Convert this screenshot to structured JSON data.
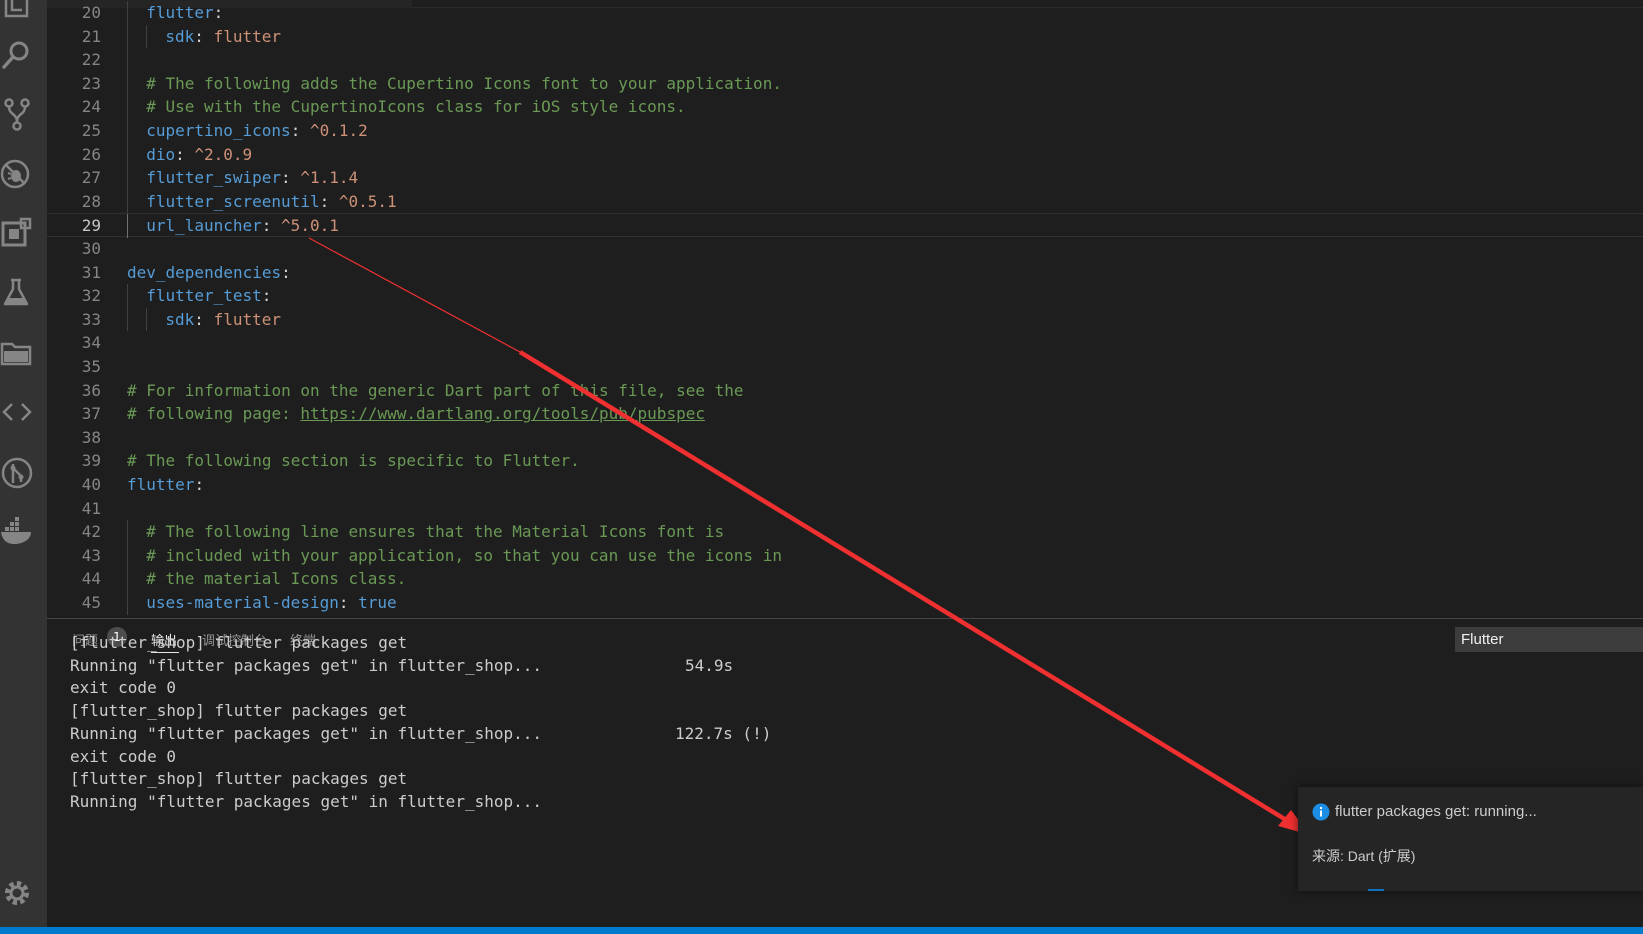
{
  "editor": {
    "lines": [
      {
        "n": "20",
        "indent": 1,
        "tokens": [
          {
            "t": "flutter",
            "c": "t-key"
          },
          {
            "t": ":",
            "c": "t-punc"
          }
        ]
      },
      {
        "n": "21",
        "indent": 2,
        "tokens": [
          {
            "t": "sdk",
            "c": "t-key"
          },
          {
            "t": ": ",
            "c": "t-punc"
          },
          {
            "t": "flutter",
            "c": "t-str"
          }
        ]
      },
      {
        "n": "22",
        "indent": 1,
        "tokens": []
      },
      {
        "n": "23",
        "indent": 1,
        "tokens": [
          {
            "t": "# The following adds the Cupertino Icons font to your application.",
            "c": "t-com"
          }
        ]
      },
      {
        "n": "24",
        "indent": 1,
        "tokens": [
          {
            "t": "# Use with the CupertinoIcons class for iOS style icons.",
            "c": "t-com"
          }
        ]
      },
      {
        "n": "25",
        "indent": 1,
        "tokens": [
          {
            "t": "cupertino_icons",
            "c": "t-key"
          },
          {
            "t": ": ",
            "c": "t-punc"
          },
          {
            "t": "^0.1.2",
            "c": "t-str"
          }
        ]
      },
      {
        "n": "26",
        "indent": 1,
        "tokens": [
          {
            "t": "dio",
            "c": "t-key"
          },
          {
            "t": ": ",
            "c": "t-punc"
          },
          {
            "t": "^2.0.9",
            "c": "t-str"
          }
        ]
      },
      {
        "n": "27",
        "indent": 1,
        "tokens": [
          {
            "t": "flutter_swiper",
            "c": "t-key"
          },
          {
            "t": ": ",
            "c": "t-punc"
          },
          {
            "t": "^1.1.4",
            "c": "t-str"
          }
        ]
      },
      {
        "n": "28",
        "indent": 1,
        "tokens": [
          {
            "t": "flutter_screenutil",
            "c": "t-key"
          },
          {
            "t": ": ",
            "c": "t-punc"
          },
          {
            "t": "^0.5.1",
            "c": "t-str"
          }
        ]
      },
      {
        "n": "29",
        "indent": 1,
        "current": true,
        "tokens": [
          {
            "t": "url_launcher",
            "c": "t-key"
          },
          {
            "t": ": ",
            "c": "t-punc"
          },
          {
            "t": "^5.0.1",
            "c": "t-str"
          }
        ]
      },
      {
        "n": "30",
        "indent": 0,
        "tokens": []
      },
      {
        "n": "31",
        "indent": 0,
        "tokens": [
          {
            "t": "dev_dependencies",
            "c": "t-key"
          },
          {
            "t": ":",
            "c": "t-punc"
          }
        ]
      },
      {
        "n": "32",
        "indent": 1,
        "tokens": [
          {
            "t": "flutter_test",
            "c": "t-key"
          },
          {
            "t": ":",
            "c": "t-punc"
          }
        ]
      },
      {
        "n": "33",
        "indent": 2,
        "tokens": [
          {
            "t": "sdk",
            "c": "t-key"
          },
          {
            "t": ": ",
            "c": "t-punc"
          },
          {
            "t": "flutter",
            "c": "t-str"
          }
        ]
      },
      {
        "n": "34",
        "indent": 0,
        "tokens": []
      },
      {
        "n": "35",
        "indent": 0,
        "tokens": []
      },
      {
        "n": "36",
        "indent": 0,
        "tokens": [
          {
            "t": "# For information on the generic Dart part of this file, see the",
            "c": "t-com"
          }
        ]
      },
      {
        "n": "37",
        "indent": 0,
        "tokens": [
          {
            "t": "# following page: ",
            "c": "t-com"
          },
          {
            "t": "https://www.dartlang.org/tools/pub/pubspec",
            "c": "t-link"
          }
        ]
      },
      {
        "n": "38",
        "indent": 0,
        "tokens": []
      },
      {
        "n": "39",
        "indent": 0,
        "tokens": [
          {
            "t": "# The following section is specific to Flutter.",
            "c": "t-com"
          }
        ]
      },
      {
        "n": "40",
        "indent": 0,
        "tokens": [
          {
            "t": "flutter",
            "c": "t-key"
          },
          {
            "t": ":",
            "c": "t-punc"
          }
        ]
      },
      {
        "n": "41",
        "indent": 0,
        "tokens": []
      },
      {
        "n": "42",
        "indent": 1,
        "tokens": [
          {
            "t": "# The following line ensures that the Material Icons font is",
            "c": "t-com"
          }
        ]
      },
      {
        "n": "43",
        "indent": 1,
        "tokens": [
          {
            "t": "# included with your application, so that you can use the icons in",
            "c": "t-com"
          }
        ]
      },
      {
        "n": "44",
        "indent": 1,
        "tokens": [
          {
            "t": "# the material Icons class.",
            "c": "t-com"
          }
        ]
      },
      {
        "n": "45",
        "indent": 1,
        "tokens": [
          {
            "t": "uses-material-design",
            "c": "t-key"
          },
          {
            "t": ": ",
            "c": "t-punc"
          },
          {
            "t": "true",
            "c": "t-kw"
          }
        ]
      }
    ]
  },
  "panel": {
    "tabs": {
      "problems": "问题",
      "problems_count": "1",
      "output": "输出",
      "debug_console": "调试控制台",
      "terminal": "终端"
    },
    "output_channel": "Flutter",
    "output_lines": [
      {
        "text": "[flutter_shop] flutter packages get",
        "time": ""
      },
      {
        "text": "Running \"flutter packages get\" in flutter_shop...",
        "time": "54.9s"
      },
      {
        "text": "exit code 0",
        "time": ""
      },
      {
        "text": "[flutter_shop] flutter packages get",
        "time": ""
      },
      {
        "text": "Running \"flutter packages get\" in flutter_shop...",
        "time": "122.7s (!)"
      },
      {
        "text": "exit code 0",
        "time": ""
      },
      {
        "text": "[flutter_shop] flutter packages get",
        "time": ""
      },
      {
        "text": "Running \"flutter packages get\" in flutter_shop...",
        "time": ""
      }
    ]
  },
  "notification": {
    "message": "flutter packages get: running...",
    "source": "来源: Dart (扩展)",
    "icon": "info-icon"
  },
  "activity_bar": {
    "icons": [
      "explorer-icon",
      "search-icon",
      "source-control-icon",
      "debug-icon",
      "extensions-icon",
      "test-icon",
      "folder-icon",
      "code-icon",
      "git-graph-icon",
      "docker-icon",
      "gear-icon"
    ]
  },
  "colors": {
    "key": "#569cd6",
    "string": "#ce9178",
    "comment": "#6a9955",
    "status_bar": "#007acc",
    "arrow": "#f03030"
  }
}
